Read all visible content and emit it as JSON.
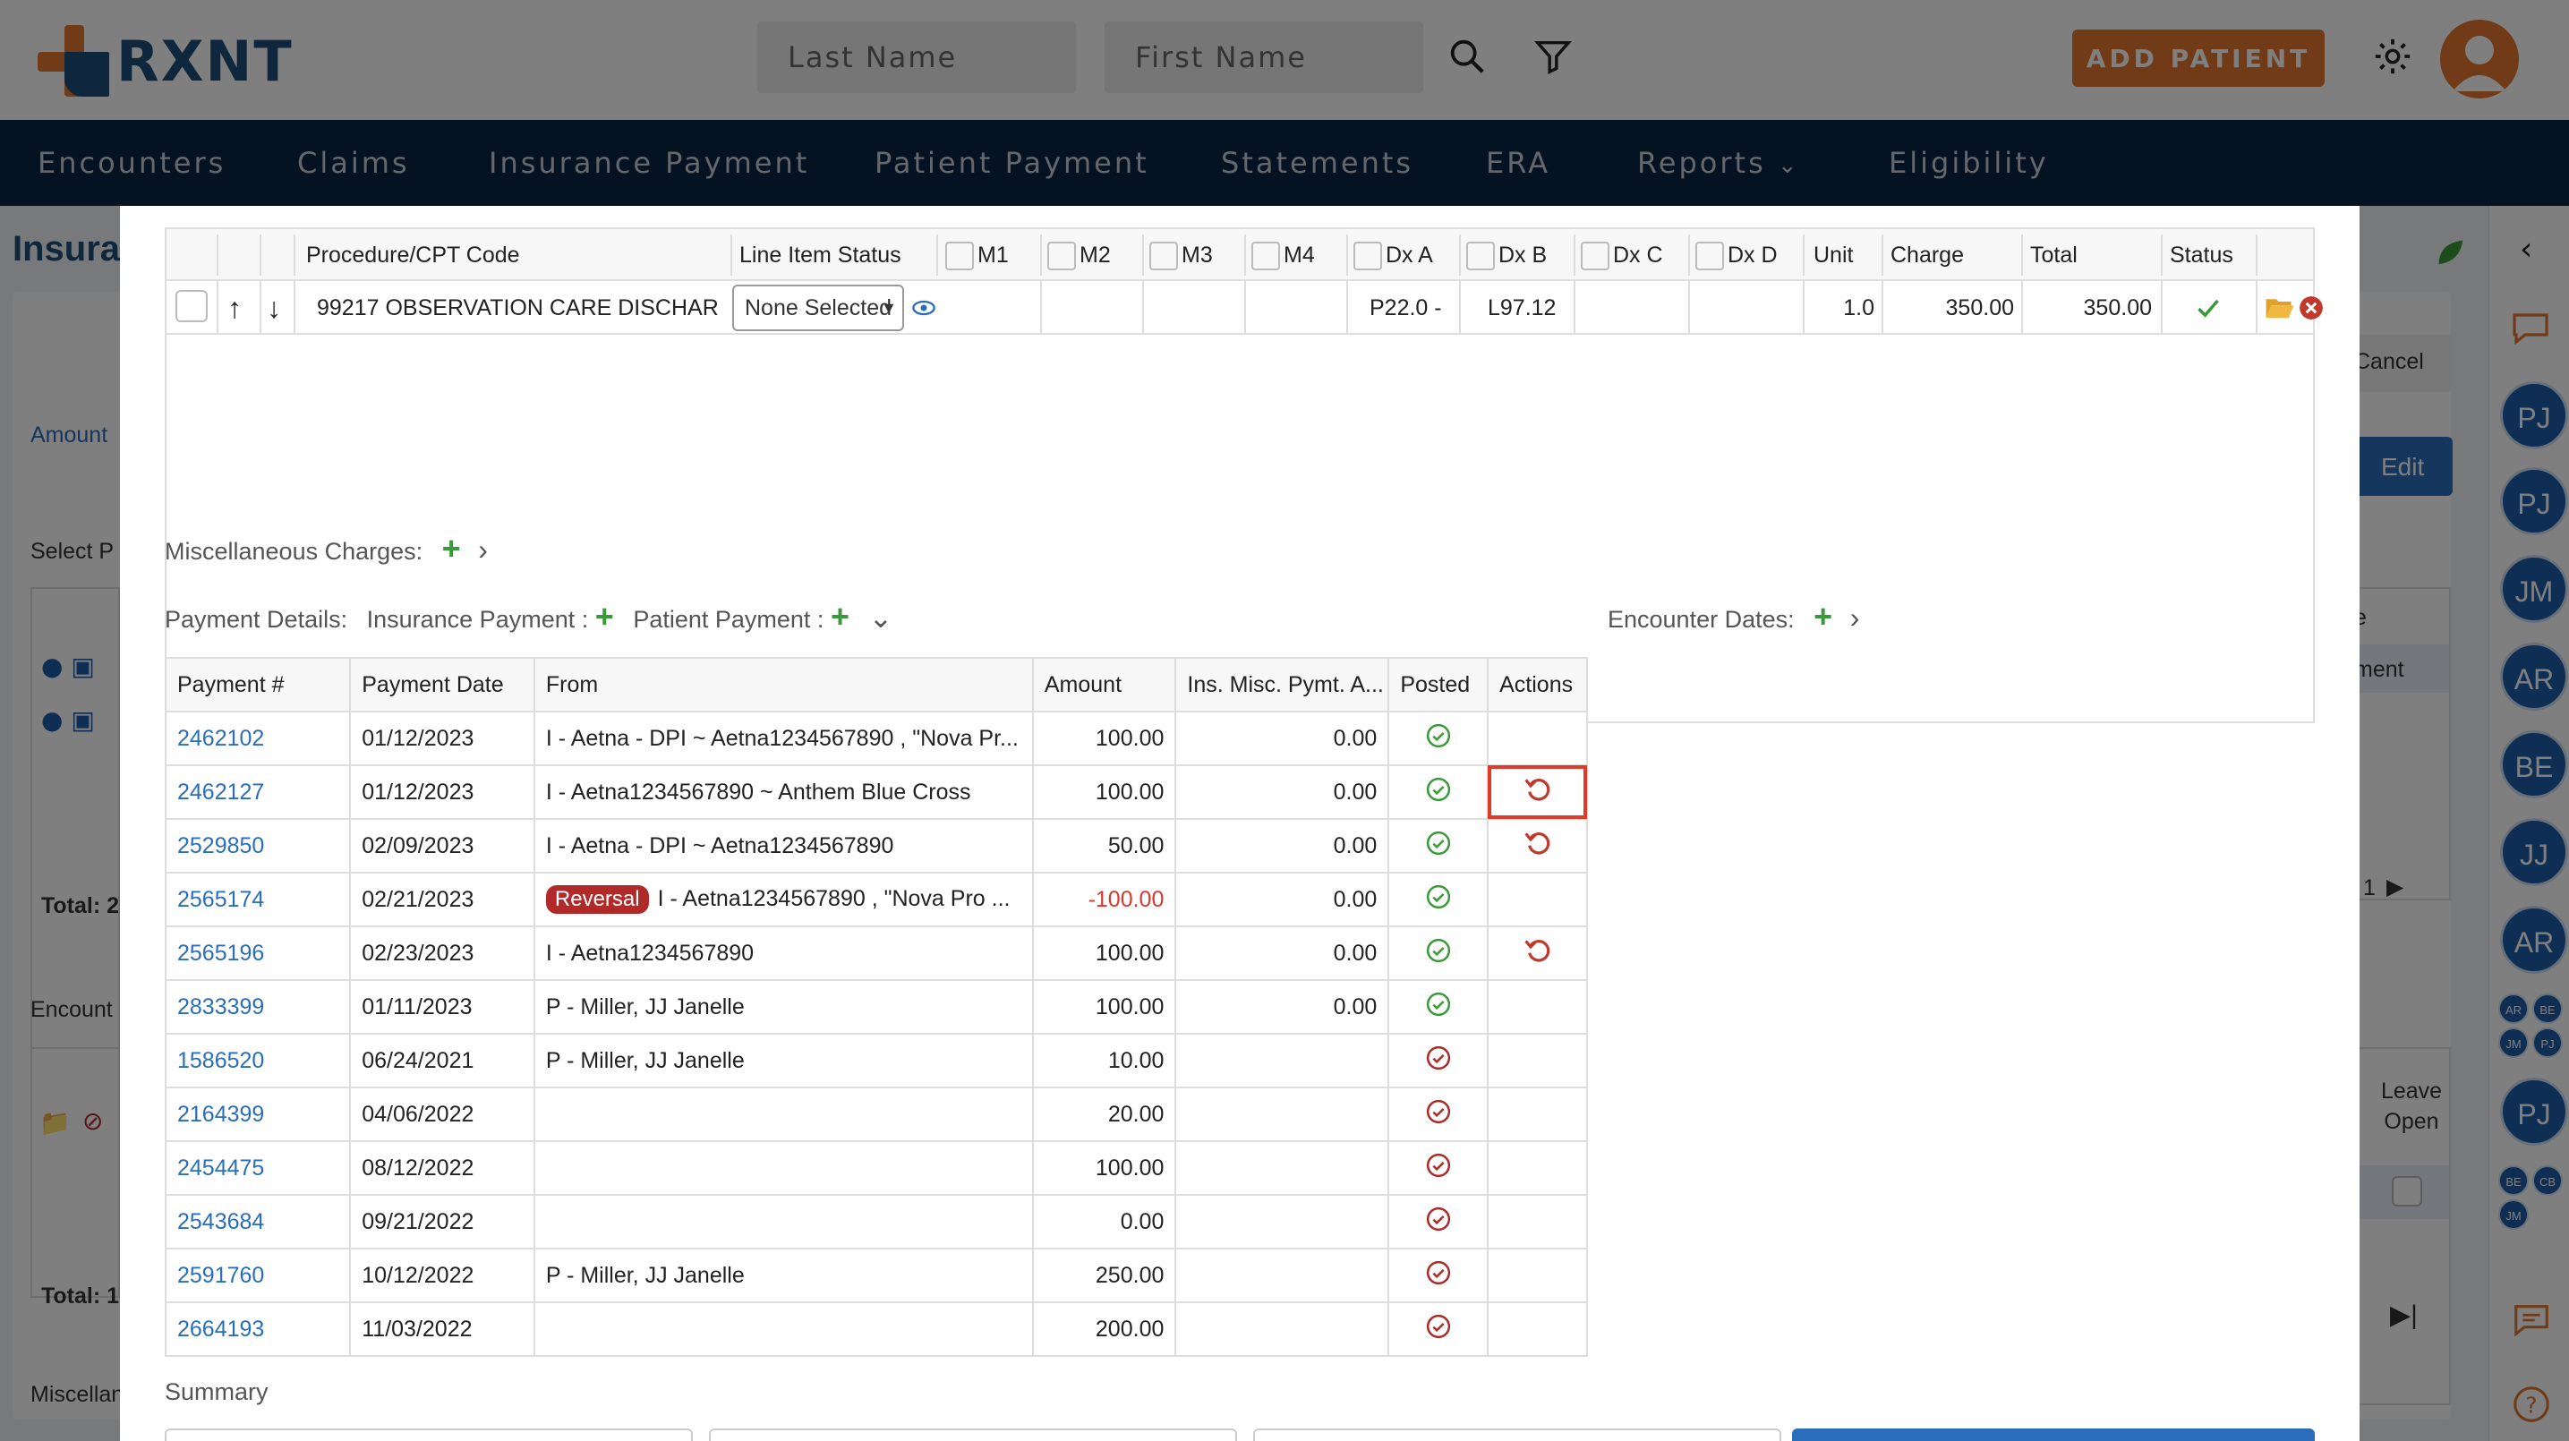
{
  "header": {
    "logo_text": "RXNT",
    "last_name_placeholder": "Last Name",
    "first_name_placeholder": "First Name",
    "add_patient_label": "ADD PATIENT",
    "icons": [
      "search-icon",
      "filter-icon",
      "gear-icon",
      "user-avatar"
    ]
  },
  "nav": {
    "items": [
      "Encounters",
      "Claims",
      "Insurance Payment",
      "Patient Payment",
      "Statements",
      "ERA",
      "Reports",
      "Eligibility"
    ]
  },
  "background": {
    "page_title": "Insura",
    "amount_label": "Amount",
    "select_label": "Select P",
    "total_1": "Total: 2",
    "encounter_label": "Encount",
    "total_2": "Total: 1",
    "misc_label": "Miscellan",
    "cancel_label": "Cancel",
    "edit_label": "Edit",
    "right_e": "e",
    "right_ment": "ment",
    "page_num": "1",
    "leave_open": "Leave Open",
    "rail_avatars": [
      "PJ",
      "PJ",
      "JM",
      "AR",
      "BE",
      "JJ",
      "AR"
    ],
    "rail_small_1": [
      "AR",
      "BE",
      "JM",
      "PJ"
    ],
    "rail_pj": "PJ",
    "rail_small_2": [
      "BE",
      "CB",
      "JM"
    ]
  },
  "line_items": {
    "headers": {
      "code": "Procedure/CPT Code",
      "status": "Line Item Status",
      "m1": "M1",
      "m2": "M2",
      "m3": "M3",
      "m4": "M4",
      "dxa": "Dx A",
      "dxb": "Dx B",
      "dxc": "Dx C",
      "dxd": "Dx D",
      "unit": "Unit",
      "charge": "Charge",
      "total": "Total",
      "status_col": "Status"
    },
    "row": {
      "code": "99217 OBSERVATION CARE DISCHAR",
      "status_select": "None Selected",
      "dxa": "P22.0 -",
      "dxb": "L97.12",
      "unit": "1.0",
      "charge": "350.00",
      "total": "350.00"
    }
  },
  "misc_charges_label": "Miscellaneous Charges:",
  "payment_details": {
    "label": "Payment Details:",
    "insurance_payment": "Insurance Payment :",
    "patient_payment": "Patient Payment :",
    "encounter_dates": "Encounter Dates:"
  },
  "payments": {
    "headers": [
      "Payment #",
      "Payment Date",
      "From",
      "Amount",
      "Ins. Misc. Pymt. A...",
      "Posted",
      "Actions"
    ],
    "rows": [
      {
        "id": "2462102",
        "date": "01/12/2023",
        "from": "I - Aetna - DPI ~ Aetna1234567890 , \"Nova Pr...",
        "amount": "100.00",
        "misc": "0.00",
        "posted": true,
        "action": false,
        "badge": ""
      },
      {
        "id": "2462127",
        "date": "01/12/2023",
        "from": "I - Aetna1234567890 ~ Anthem Blue Cross",
        "amount": "100.00",
        "misc": "0.00",
        "posted": true,
        "action": true,
        "badge": ""
      },
      {
        "id": "2529850",
        "date": "02/09/2023",
        "from": "I - Aetna - DPI ~ Aetna1234567890",
        "amount": "50.00",
        "misc": "0.00",
        "posted": true,
        "action": true,
        "badge": ""
      },
      {
        "id": "2565174",
        "date": "02/21/2023",
        "from": "I - Aetna1234567890 , \"Nova Pro ...",
        "amount": "-100.00",
        "misc": "0.00",
        "posted": true,
        "action": false,
        "badge": "Reversal"
      },
      {
        "id": "2565196",
        "date": "02/23/2023",
        "from": "I - Aetna1234567890",
        "amount": "100.00",
        "misc": "0.00",
        "posted": true,
        "action": true,
        "badge": ""
      },
      {
        "id": "2833399",
        "date": "01/11/2023",
        "from": "P - Miller, JJ Janelle",
        "amount": "100.00",
        "misc": "0.00",
        "posted": true,
        "action": false,
        "badge": ""
      },
      {
        "id": "1586520",
        "date": "06/24/2021",
        "from": "P - Miller, JJ Janelle",
        "amount": "10.00",
        "misc": "",
        "posted": false,
        "action": false,
        "badge": ""
      },
      {
        "id": "2164399",
        "date": "04/06/2022",
        "from": "",
        "amount": "20.00",
        "misc": "",
        "posted": false,
        "action": false,
        "badge": ""
      },
      {
        "id": "2454475",
        "date": "08/12/2022",
        "from": "",
        "amount": "100.00",
        "misc": "",
        "posted": false,
        "action": false,
        "badge": ""
      },
      {
        "id": "2543684",
        "date": "09/21/2022",
        "from": "",
        "amount": "0.00",
        "misc": "",
        "posted": false,
        "action": false,
        "badge": ""
      },
      {
        "id": "2591760",
        "date": "10/12/2022",
        "from": "P - Miller, JJ Janelle",
        "amount": "250.00",
        "misc": "",
        "posted": false,
        "action": false,
        "badge": ""
      },
      {
        "id": "2664193",
        "date": "11/03/2022",
        "from": "",
        "amount": "200.00",
        "misc": "",
        "posted": false,
        "action": false,
        "badge": ""
      }
    ]
  },
  "summary_label": "Summary",
  "colors": {
    "brand_orange": "#e0772d",
    "brand_navy": "#0b2545",
    "link": "#2a6ebb",
    "posted_green": "#3a9a3a",
    "unposted_red": "#b02a2a",
    "highlight": "#e03a2a"
  }
}
